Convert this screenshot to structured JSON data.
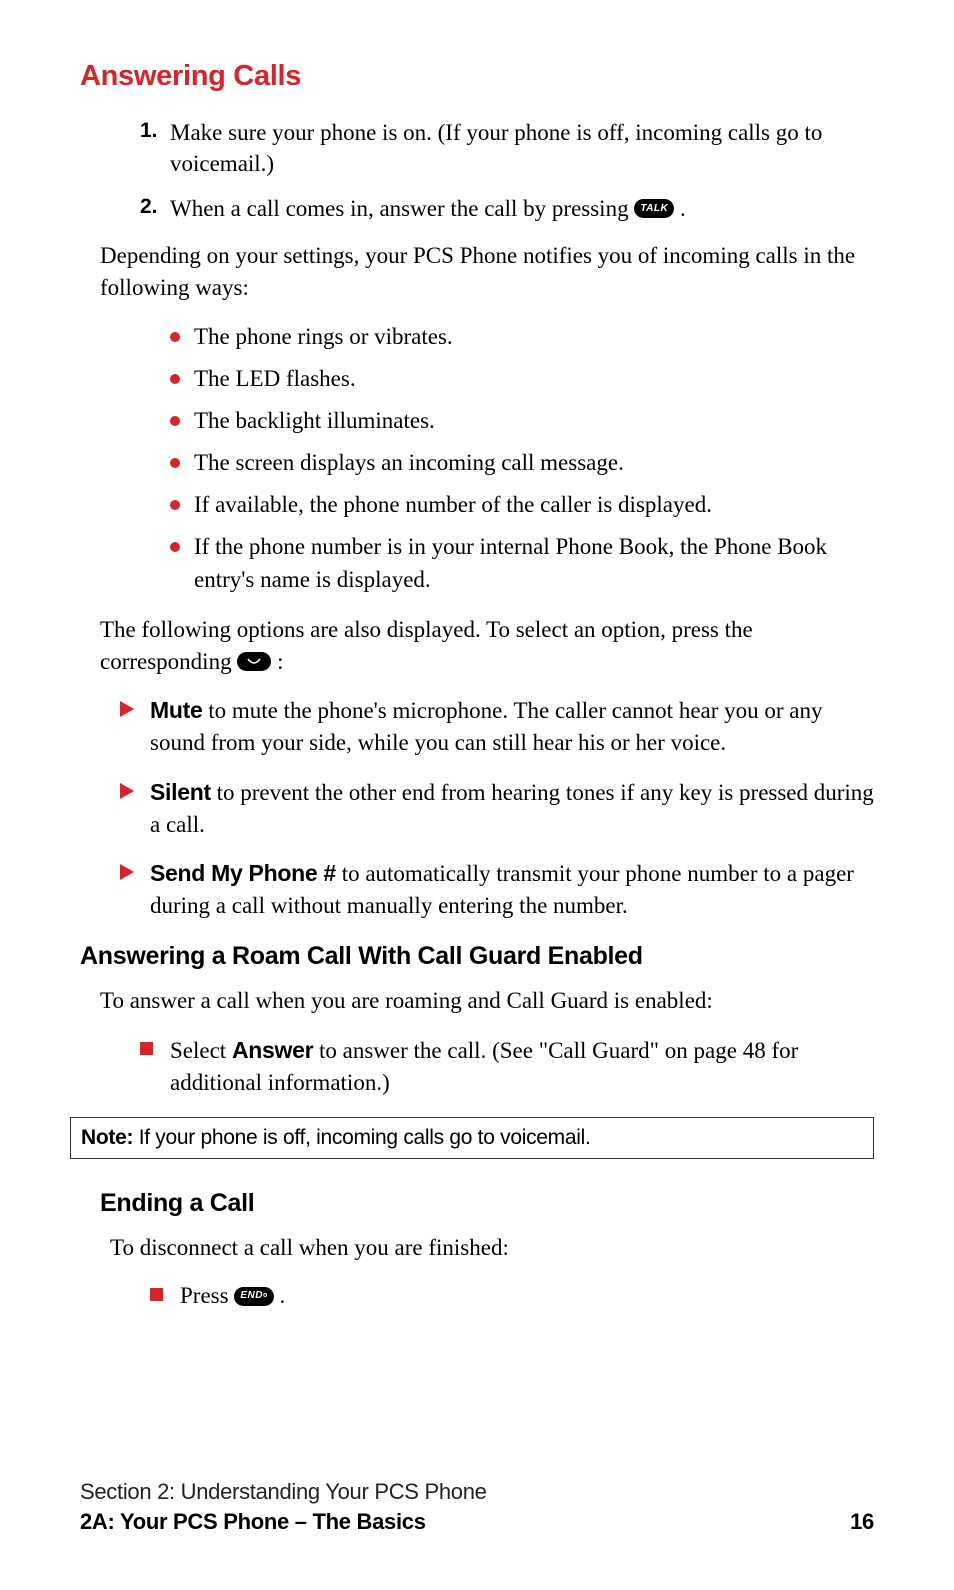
{
  "section_title": "Answering Calls",
  "steps": [
    {
      "num": "1.",
      "text": "Make sure your phone is on. (If your phone is off, incoming calls go to voicemail.)"
    },
    {
      "num": "2.",
      "prefix": "When a call comes in, answer the call by pressing ",
      "key": "TALK",
      "suffix": " ."
    }
  ],
  "para_intro": "Depending on your settings, your PCS Phone notifies you of incoming calls in the following ways:",
  "notify_ways": [
    "The phone rings or vibrates.",
    "The LED flashes.",
    "The backlight illuminates.",
    "The screen displays an incoming call message.",
    "If available, the phone number of the caller is displayed.",
    "If the phone number is in your internal Phone Book, the Phone Book entry's name is displayed."
  ],
  "para_options_prefix": "The following options are also displayed. To select an option, press the corresponding ",
  "para_options_suffix": " :",
  "options": [
    {
      "label": "Mute",
      "text": " to mute the phone's microphone.  The caller cannot hear you or any sound from your side, while you can still hear his or her voice."
    },
    {
      "label": "Silent",
      "text": " to prevent the other end from hearing tones if any key is pressed during a call."
    },
    {
      "label": "Send My Phone #",
      "text": " to automatically transmit your phone number to a pager during a call without manually entering the number."
    }
  ],
  "roam_heading": "Answering a Roam Call With Call Guard Enabled",
  "roam_intro": "To answer a call when you are roaming and Call Guard is enabled:",
  "roam_item_prefix": "Select ",
  "roam_item_bold": "Answer",
  "roam_item_suffix": " to answer the call. (See \"Call Guard\" on page 48 for additional information.)",
  "note_label": "Note:",
  "note_text": " If your phone is off, incoming calls go to voicemail.",
  "ending_heading": "Ending a Call",
  "ending_intro": "To disconnect a call when you are finished:",
  "ending_item_prefix": "Press ",
  "ending_key": "END",
  "ending_item_suffix": " .",
  "footer_line1": "Section 2: Understanding Your PCS Phone",
  "footer_line2": "2A: Your PCS Phone – The Basics",
  "page_number": "16"
}
